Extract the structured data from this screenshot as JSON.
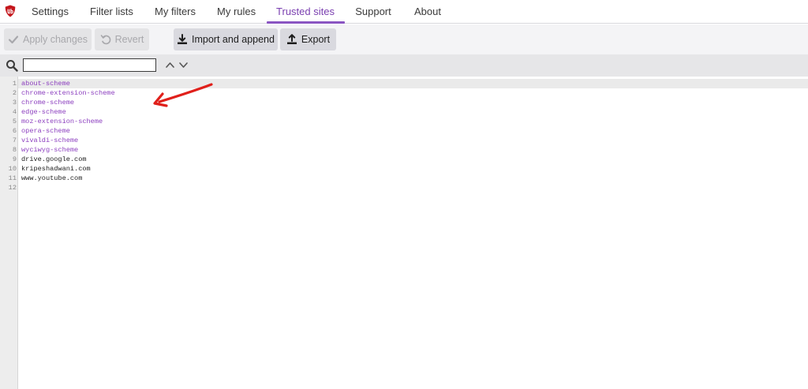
{
  "tabs": [
    {
      "label": "Settings",
      "active": false
    },
    {
      "label": "Filter lists",
      "active": false
    },
    {
      "label": "My filters",
      "active": false
    },
    {
      "label": "My rules",
      "active": false
    },
    {
      "label": "Trusted sites",
      "active": true
    },
    {
      "label": "Support",
      "active": false
    },
    {
      "label": "About",
      "active": false
    }
  ],
  "toolbar": {
    "apply_label": "Apply changes",
    "revert_label": "Revert",
    "import_label": "Import and append",
    "export_label": "Export"
  },
  "search": {
    "value": ""
  },
  "editor": {
    "lines": [
      {
        "num": "1",
        "text": "about-scheme",
        "kind": "scheme"
      },
      {
        "num": "2",
        "text": "chrome-extension-scheme",
        "kind": "scheme"
      },
      {
        "num": "3",
        "text": "chrome-scheme",
        "kind": "scheme"
      },
      {
        "num": "4",
        "text": "edge-scheme",
        "kind": "scheme"
      },
      {
        "num": "5",
        "text": "moz-extension-scheme",
        "kind": "scheme"
      },
      {
        "num": "6",
        "text": "opera-scheme",
        "kind": "scheme"
      },
      {
        "num": "7",
        "text": "vivaldi-scheme",
        "kind": "scheme"
      },
      {
        "num": "8",
        "text": "wyciwyg-scheme",
        "kind": "scheme"
      },
      {
        "num": "9",
        "text": "drive.google.com",
        "kind": "host"
      },
      {
        "num": "10",
        "text": "kripeshadwani.com",
        "kind": "host"
      },
      {
        "num": "11",
        "text": "www.youtube.com",
        "kind": "host"
      },
      {
        "num": "12",
        "text": "",
        "kind": "host"
      }
    ]
  },
  "colors": {
    "accent": "#8a55c2",
    "scheme_text": "#8c3fbf",
    "arrow": "#e0201b",
    "logo": "#c4161c"
  },
  "icons": {
    "logo": "ublock-shield-icon",
    "apply": "checkmark-icon",
    "revert": "undo-icon",
    "import": "download-icon",
    "export": "upload-icon",
    "search": "search-icon",
    "prev": "chevron-up-icon",
    "next": "chevron-down-icon",
    "annotation": "red-arrow-icon"
  }
}
